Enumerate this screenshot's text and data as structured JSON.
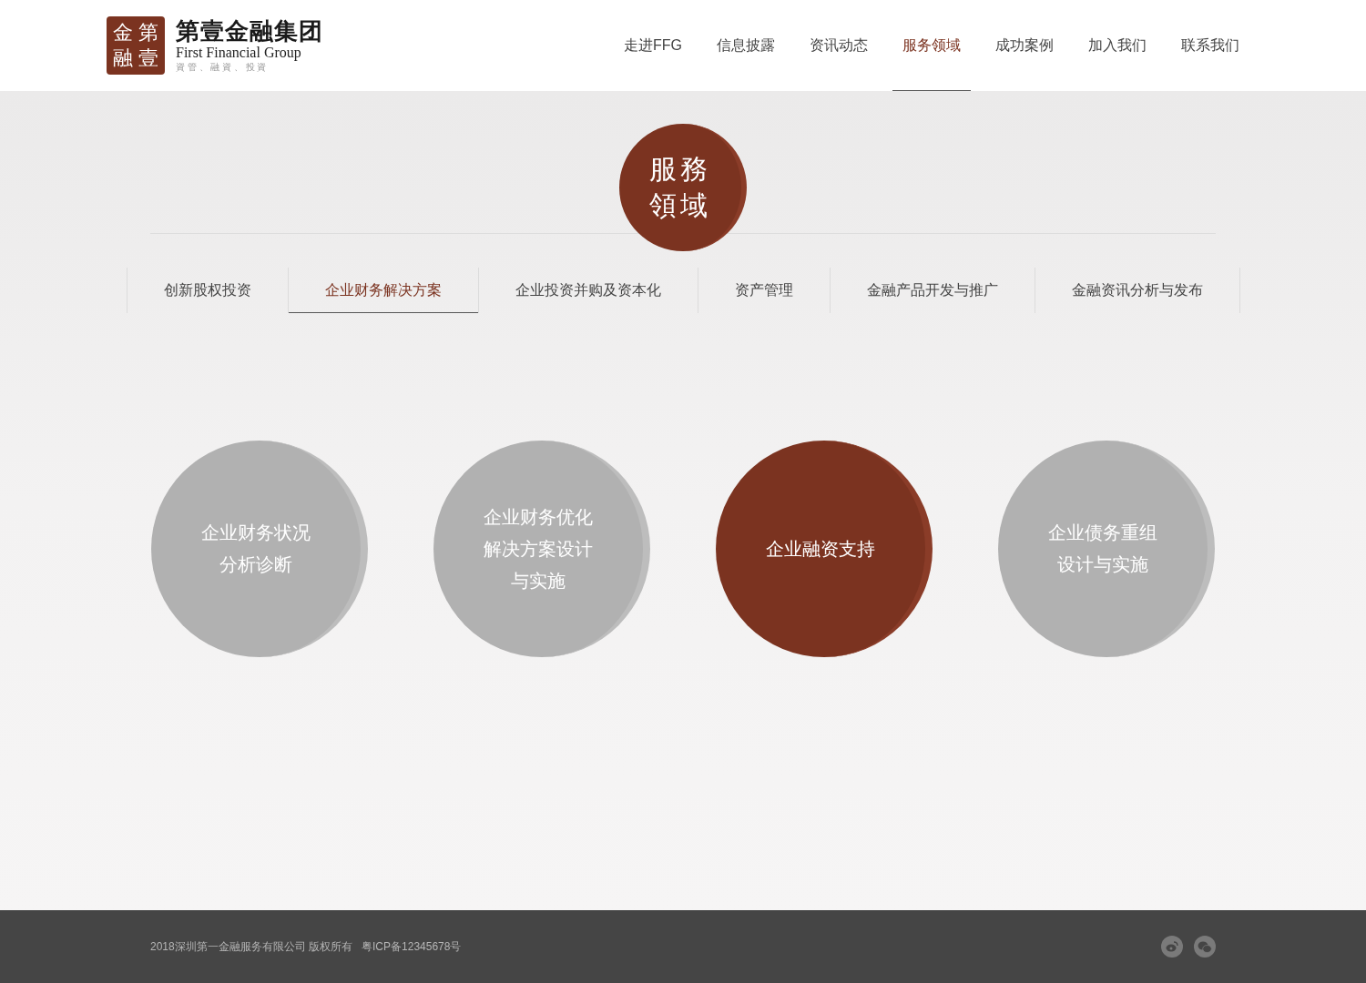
{
  "header": {
    "logo": {
      "seal_chars": [
        "金",
        "第",
        "融",
        "壹"
      ],
      "name": "第壹金融集团",
      "english": "First Financial Group",
      "slogan": "資 管 、 融 資 、 投 資"
    },
    "nav": [
      {
        "label": "走进FFG",
        "selected": false
      },
      {
        "label": "信息披露",
        "selected": false
      },
      {
        "label": "资讯动态",
        "selected": false
      },
      {
        "label": "服务领域",
        "selected": true
      },
      {
        "label": "成功案例",
        "selected": false
      },
      {
        "label": "加入我们",
        "selected": false
      },
      {
        "label": "联系我们",
        "selected": false
      }
    ]
  },
  "section_seal": {
    "lines": [
      "服務",
      "領域"
    ]
  },
  "tabs": [
    {
      "label": "创新股权投资",
      "selected": false
    },
    {
      "label": "企业财务解决方案",
      "selected": true
    },
    {
      "label": "企业投资并购及资本化",
      "selected": false
    },
    {
      "label": "资产管理",
      "selected": false
    },
    {
      "label": "金融产品开发与推广",
      "selected": false
    },
    {
      "label": "金融资讯分析与发布",
      "selected": false
    }
  ],
  "services": [
    {
      "lines": [
        "企业财务状况",
        "分析诊断"
      ],
      "selected": false
    },
    {
      "lines": [
        "企业财务优化",
        "解决方案设计",
        "与实施"
      ],
      "selected": false
    },
    {
      "lines": [
        "企业融资支持"
      ],
      "selected": true
    },
    {
      "lines": [
        "企业债务重组",
        "设计与实施"
      ],
      "selected": false
    }
  ],
  "footer": {
    "copyright": "2018深圳第一金融服务有限公司 版权所有",
    "icp": "粤ICP备12345678号"
  }
}
